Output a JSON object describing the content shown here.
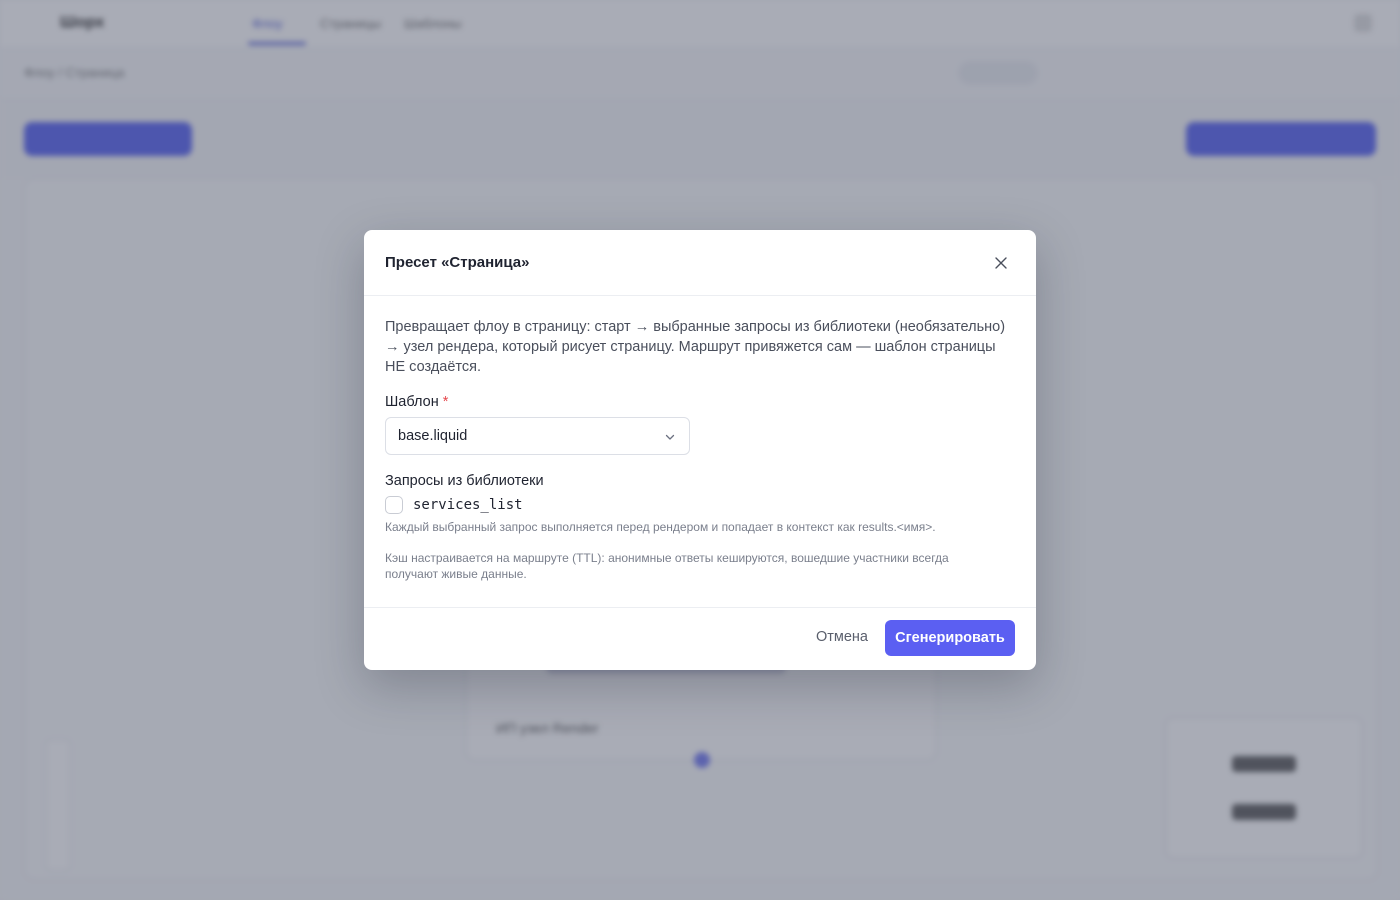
{
  "background": {
    "logo": "Шорх",
    "nav": [
      "Флоу",
      "Страницы",
      "Шаблоны"
    ],
    "breadcrumb": "Флоу / Страница",
    "node_subtitle": "ИП узел Render"
  },
  "modal": {
    "title": "Пресет «Страница»",
    "description": "Превращает флоу в страницу: старт → выбранные запросы из библиотеки (необязательно) → узел рендера, который рисует страницу. Маршрут привяжется сам — шаблон страницы НЕ создаётся.",
    "template_field": {
      "label": "Шаблон",
      "required_mark": "*",
      "selected_value": "base.liquid"
    },
    "queries_section": {
      "label": "Запросы из библиотеки",
      "items": [
        {
          "name": "services_list",
          "checked": false
        }
      ],
      "hint": "Каждый выбранный запрос выполняется перед рендером и попадает в контекст как results.<имя>."
    },
    "cache_hint": "Кэш настраивается на маршруте (TTL): анонимные ответы кешируются, вошедшие участники всегда получают живые данные.",
    "footer": {
      "cancel_label": "Отмена",
      "generate_label": "Сгенерировать"
    }
  },
  "colors": {
    "accent": "#5b5ff2",
    "required": "#e5484d",
    "overlay": "rgba(75,82,102,0.48)"
  }
}
